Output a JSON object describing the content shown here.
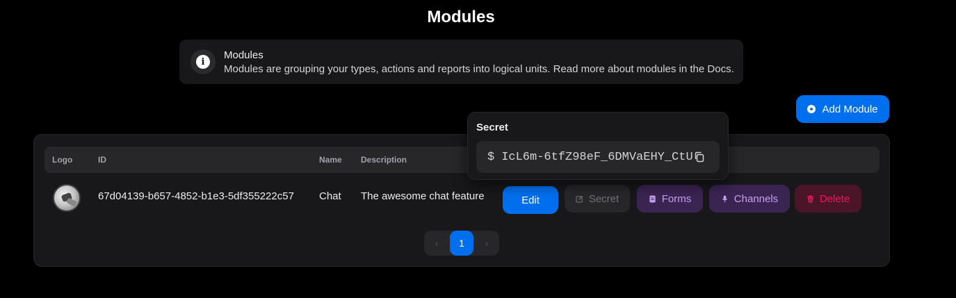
{
  "page": {
    "title": "Modules"
  },
  "info": {
    "icon": "info-icon",
    "title": "Modules",
    "description": "Modules are grouping your types, actions and reports into logical units. Read more about modules in the Docs."
  },
  "toolbar": {
    "add_label": "Add Module",
    "add_icon": "plus-circle-icon"
  },
  "table": {
    "columns": [
      "Logo",
      "ID",
      "Name",
      "Description"
    ],
    "rows": [
      {
        "logo": "avatar",
        "id": "67d04139-b657-4852-b1e3-5df355222c57",
        "name": "Chat",
        "description": "The awesome chat feature"
      }
    ],
    "actions": {
      "edit": "Edit",
      "secret": "Secret",
      "forms": "Forms",
      "channels": "Channels",
      "delete": "Delete"
    }
  },
  "pagination": {
    "current": "1",
    "prev": "‹",
    "next": "›"
  },
  "popover": {
    "title": "Secret",
    "prompt": "$",
    "value": "IcL6m-6tfZ98eF_6DMVaEHY_CtU"
  },
  "colors": {
    "primary": "#006fee",
    "secondary": "#9353d3",
    "danger": "#f31260",
    "surface": "#18181b"
  }
}
